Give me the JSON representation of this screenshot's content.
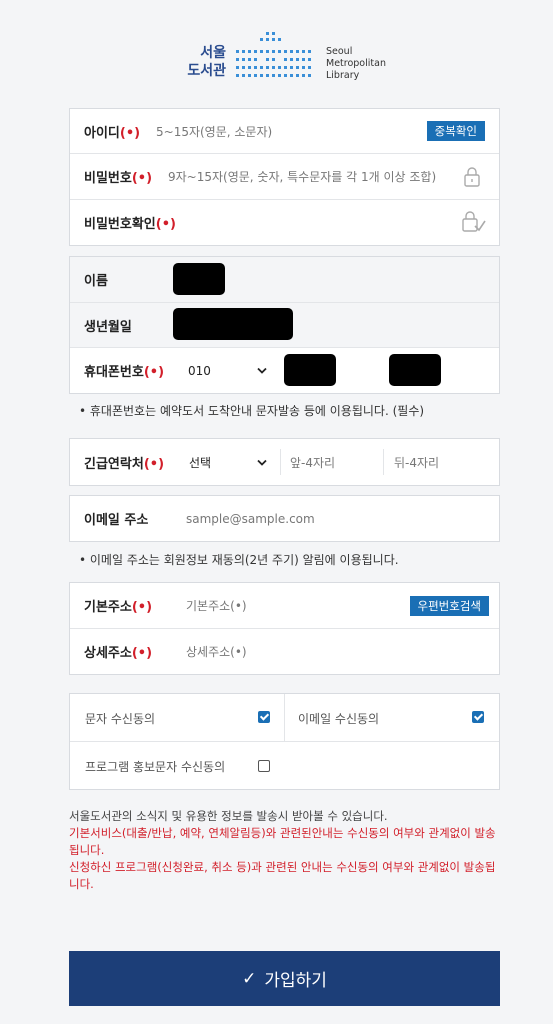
{
  "logo": {
    "ko_line1": "서울",
    "ko_line2": "도서관",
    "en_line1": "Seoul",
    "en_line2": "Metropolitan",
    "en_line3": "Library"
  },
  "account": {
    "id_label": "아이디",
    "id_placeholder": "5~15자(영문, 소문자)",
    "dup_check": "중복확인",
    "pw_label": "비밀번호",
    "pw_placeholder": "9자~15자(영문, 숫자, 특수문자를 각 1개 이상 조합)",
    "pw_confirm_label": "비밀번호확인"
  },
  "required_mark": "(•)",
  "personal": {
    "name_label": "이름",
    "birth_label": "생년월일",
    "phone_label": "휴대폰번호",
    "phone_prefix": "010",
    "phone_note": "• 휴대폰번호는 예약도서 도착안내 문자발송 등에 이용됩니다. (필수)"
  },
  "emergency": {
    "label": "긴급연락처",
    "select_value": "선택",
    "mid_placeholder": "앞-4자리",
    "last_placeholder": "뒤-4자리"
  },
  "email": {
    "label": "이메일 주소",
    "placeholder": "sample@sample.com",
    "note": "• 이메일 주소는 회원정보 재동의(2년 주기) 알림에 이용됩니다."
  },
  "address": {
    "base_label": "기본주소",
    "base_placeholder": "기본주소(•)",
    "zip_button": "우편번호검색",
    "detail_label": "상세주소",
    "detail_placeholder": "상세주소(•)"
  },
  "consent": {
    "sms_label": "문자 수신동의",
    "sms_checked": true,
    "email_label": "이메일 수신동의",
    "email_checked": true,
    "promo_label": "프로그램 홍보문자 수신동의",
    "promo_checked": false
  },
  "info_text": {
    "line1": "서울도서관의 소식지 및 유용한 정보를 발송시 받아볼 수 있습니다.",
    "line2": "기본서비스(대출/반납, 예약, 연체알림등)와 관련된안내는 수신동의 여부와 관계없이 발송됩니다.",
    "line3": "신청하신 프로그램(신청완료, 취소 등)과 관련된 안내는 수신동의 여부와 관계없이 발송됩니다."
  },
  "submit": {
    "icon": "✓",
    "label": "가입하기"
  },
  "colors": {
    "primary_blue": "#1a6fb5",
    "submit_navy": "#1c3e78",
    "required_red": "#d21f2a"
  }
}
